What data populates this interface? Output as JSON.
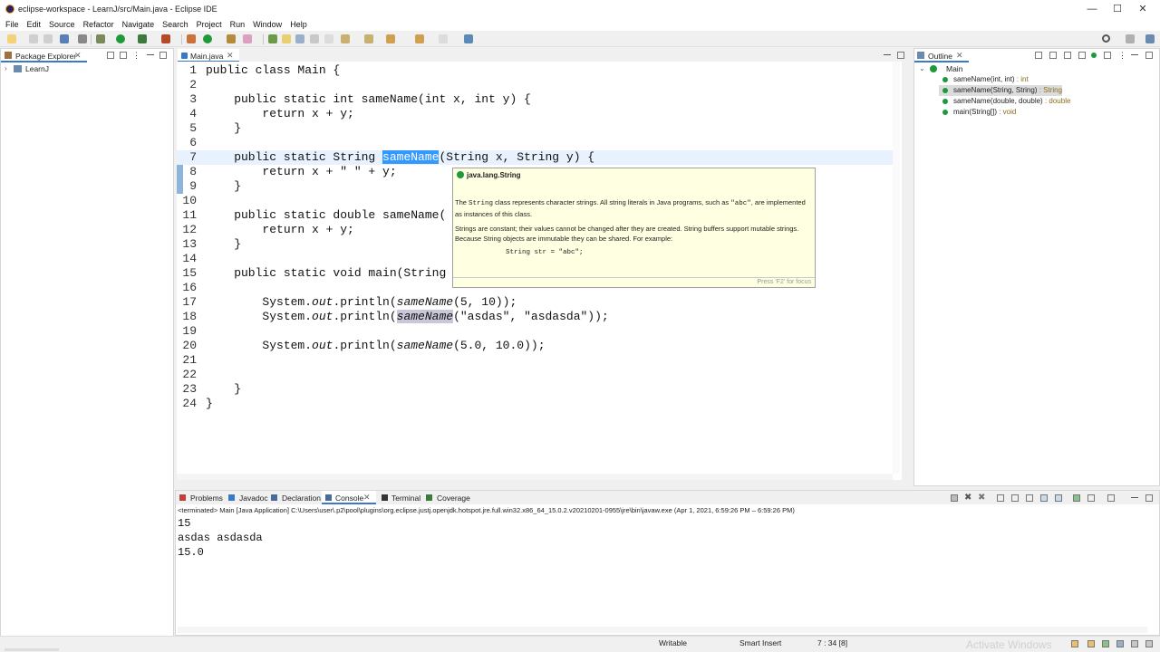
{
  "window": {
    "title": "eclipse-workspace - LearnJ/src/Main.java - Eclipse IDE",
    "min": "—",
    "max": "☐",
    "close": "✕"
  },
  "menu": [
    "File",
    "Edit",
    "Source",
    "Refactor",
    "Navigate",
    "Search",
    "Project",
    "Run",
    "Window",
    "Help"
  ],
  "package_explorer": {
    "tab": "Package Explorer",
    "project": "LearnJ"
  },
  "editor": {
    "tab": "Main.java",
    "lines": [
      {
        "n": "1",
        "text": "public class Main {"
      },
      {
        "n": "2",
        "text": ""
      },
      {
        "n": "3",
        "text": "    public static int sameName(int x, int y) {"
      },
      {
        "n": "4",
        "text": "        return x + y;"
      },
      {
        "n": "5",
        "text": "    }"
      },
      {
        "n": "6",
        "text": ""
      },
      {
        "n": "7",
        "pre": "    public static String ",
        "sel": "sameName",
        "post": "(String x, String y) {"
      },
      {
        "n": "8",
        "text": "        return x + \" \" + y;"
      },
      {
        "n": "9",
        "text": "    }"
      },
      {
        "n": "10",
        "text": ""
      },
      {
        "n": "11",
        "text": "    public static double sameName("
      },
      {
        "n": "12",
        "text": "        return x + y;"
      },
      {
        "n": "13",
        "text": "    }"
      },
      {
        "n": "14",
        "text": ""
      },
      {
        "n": "15",
        "text": "    public static void main(String"
      },
      {
        "n": "16",
        "text": ""
      },
      {
        "n": "17",
        "pre": "        System.",
        "it1": "out",
        "mid": ".println(",
        "it2": "sameName",
        "post": "(5, 10));"
      },
      {
        "n": "18",
        "pre": "        System.",
        "it1": "out",
        "mid": ".println(",
        "it2": "sameName",
        "post": "(\"asdas\", \"asdasda\"));"
      },
      {
        "n": "19",
        "text": ""
      },
      {
        "n": "20",
        "pre": "        System.",
        "it1": "out",
        "mid": ".println(",
        "it2": "sameName",
        "post": "(5.0, 10.0));"
      },
      {
        "n": "21",
        "text": ""
      },
      {
        "n": "22",
        "text": ""
      },
      {
        "n": "23",
        "text": "    }"
      },
      {
        "n": "24",
        "text": "}"
      }
    ]
  },
  "hover": {
    "title": "java.lang.String",
    "p1a": "The ",
    "p1code": "String",
    "p1b": " class represents character strings. All string literals in Java programs, such as ",
    "p1code2": "\"abc\"",
    "p1c": ", are implemented as instances of this class.",
    "p2": "Strings are constant; their values cannot be changed after they are created. String buffers support mutable strings. Because String objects are immutable they can be shared. For example:",
    "code": "String str = \"abc\";",
    "footer": "Press 'F2' for focus"
  },
  "outline": {
    "tab": "Outline",
    "root": "Main",
    "items": [
      {
        "name": "sameName(int, int)",
        "type": " : int"
      },
      {
        "name": "sameName(String, String)",
        "type": " : String"
      },
      {
        "name": "sameName(double, double)",
        "type": " : double"
      },
      {
        "name": "main(String[])",
        "type": " : void"
      }
    ]
  },
  "bottom_tabs": [
    "Problems",
    "Javadoc",
    "Declaration",
    "Console",
    "Terminal",
    "Coverage"
  ],
  "console": {
    "header": "<terminated> Main [Java Application] C:\\Users\\user\\.p2\\pool\\plugins\\org.eclipse.justj.openjdk.hotspot.jre.full.win32.x86_64_15.0.2.v20210201-0955\\jre\\bin\\javaw.exe  (Apr 1, 2021, 6:59:26 PM – 6:59:26 PM)",
    "output": [
      "15",
      "asdas asdasda",
      "15.0"
    ]
  },
  "status": {
    "writable": "Writable",
    "insert": "Smart Insert",
    "position": "7 : 34 [8]",
    "watermark": "Activate Windows"
  },
  "colors": {
    "selection": "#3399ff",
    "hover_bg": "#ffffe1",
    "current_line": "#e8f2fe"
  }
}
